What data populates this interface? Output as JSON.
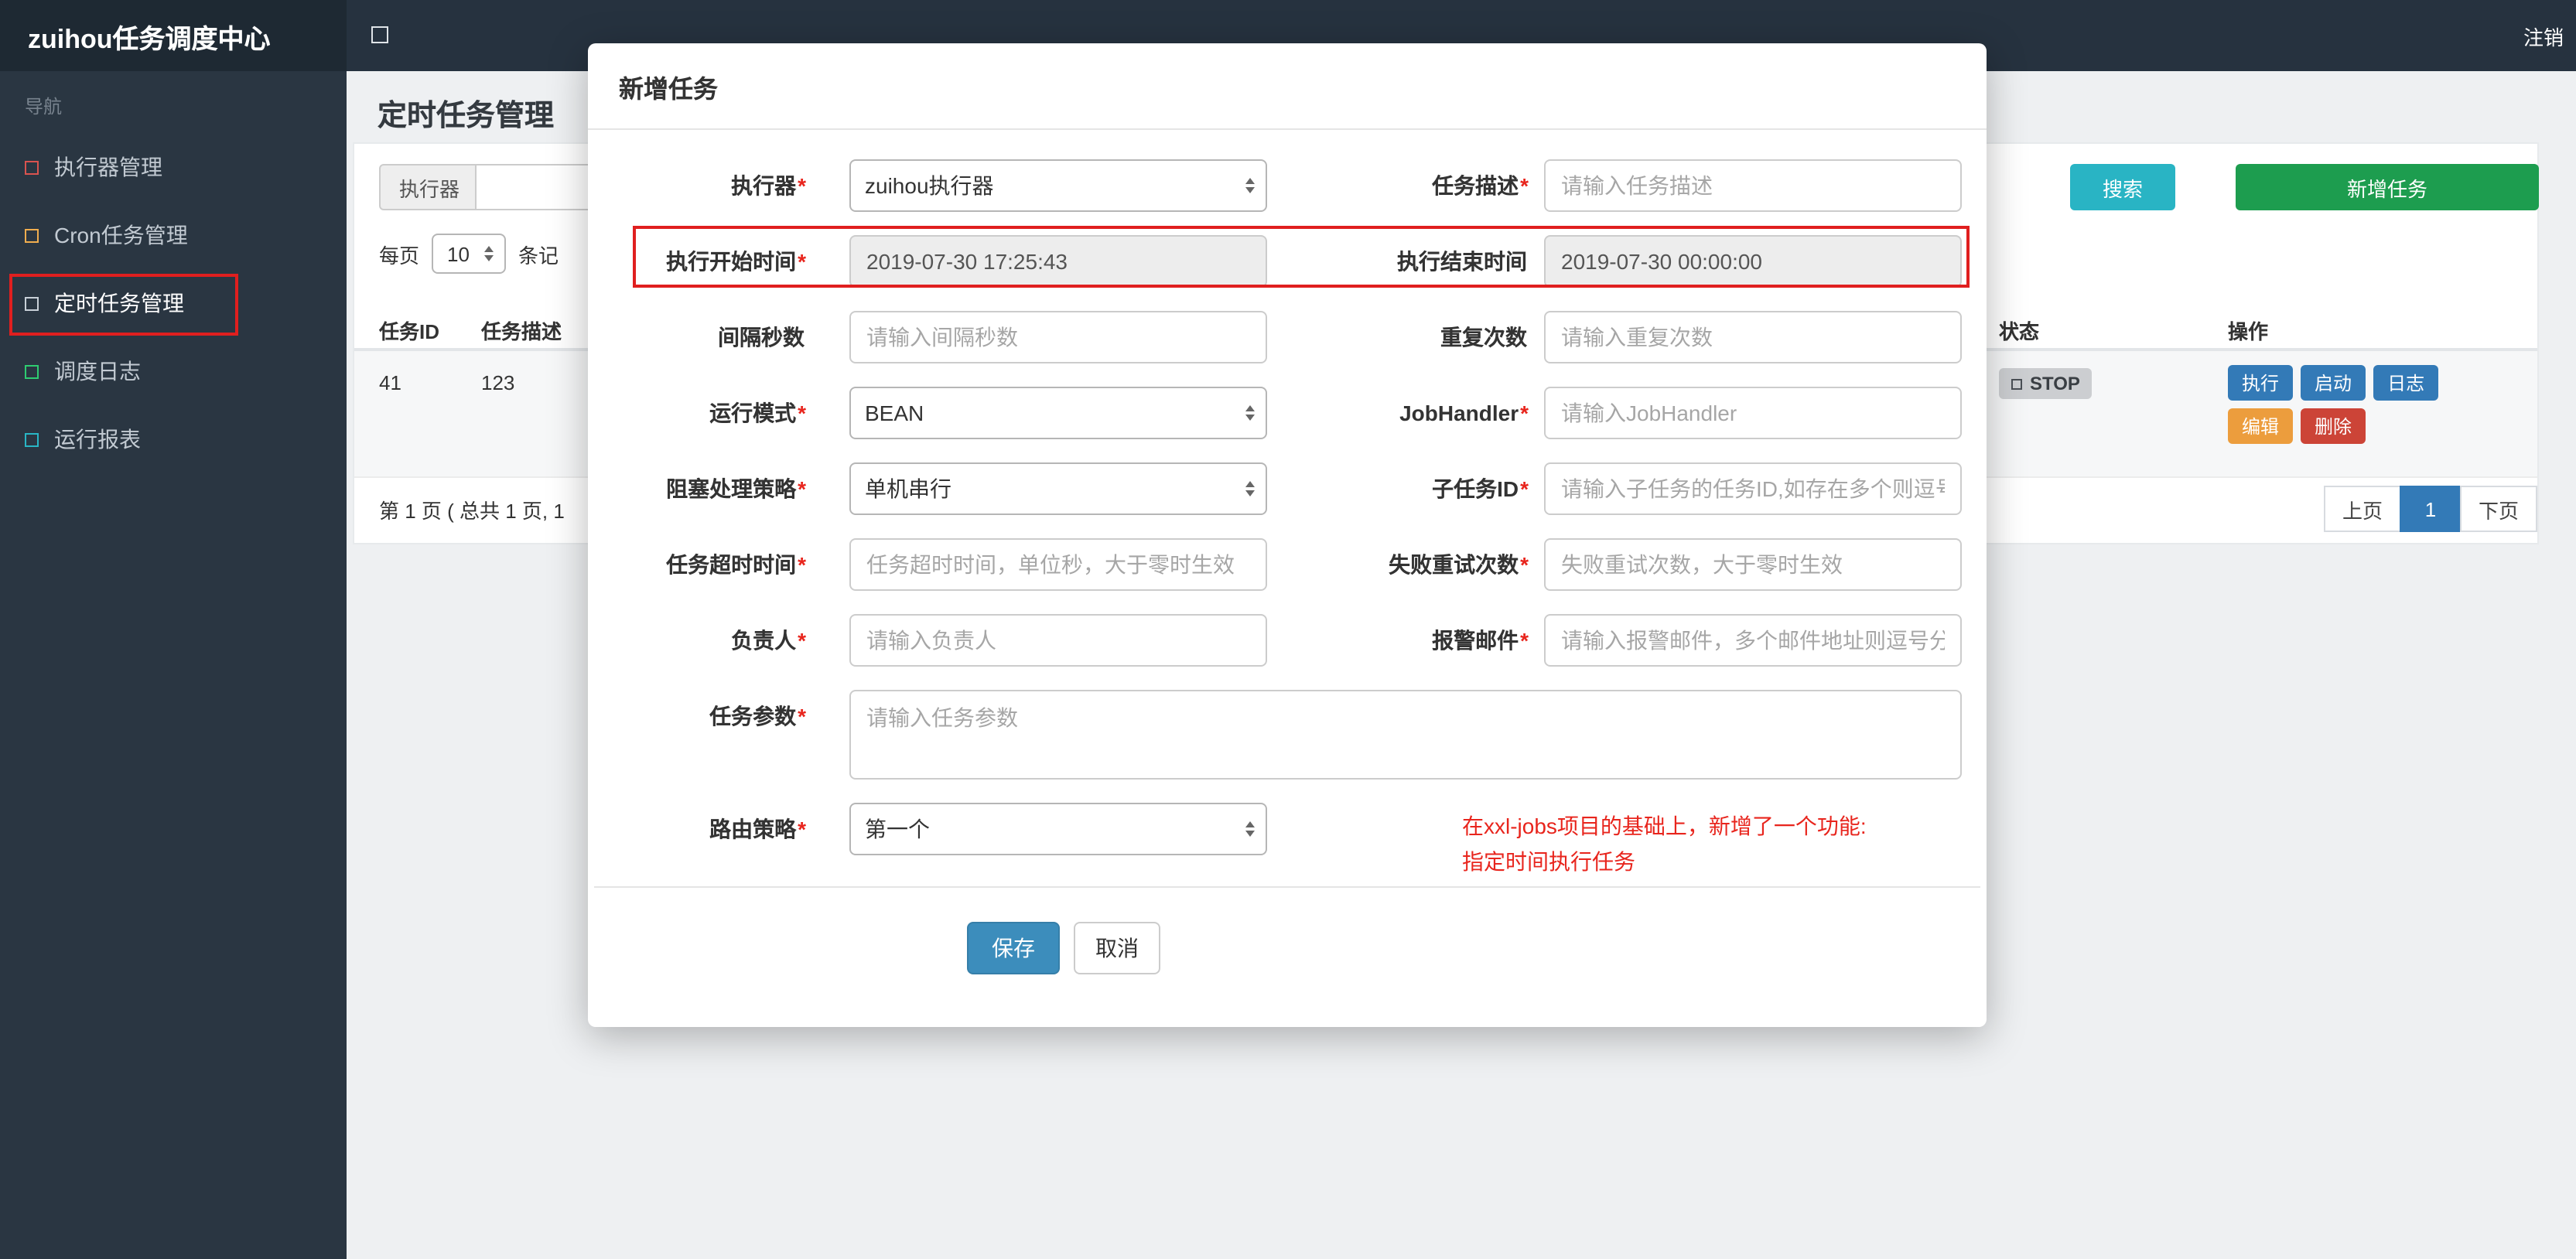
{
  "topbar": {
    "brand": "zuihou任务调度中心",
    "logout": "注销"
  },
  "sidebar": {
    "nav_label": "导航",
    "items": [
      {
        "label": "执行器管理",
        "color": "#d9534f"
      },
      {
        "label": "Cron任务管理",
        "color": "#f0ad4e"
      },
      {
        "label": "定时任务管理",
        "color": "#c8d0d8"
      },
      {
        "label": "调度日志",
        "color": "#2ecc71"
      },
      {
        "label": "运行报表",
        "color": "#29b6c5"
      }
    ]
  },
  "page": {
    "title": "定时任务管理",
    "toolbar": {
      "filter_label": "执行器",
      "search": "搜索",
      "add": "新增任务"
    },
    "perpage": {
      "prefix": "每页",
      "value": "10",
      "suffix": "条记"
    },
    "table": {
      "headers": [
        "任务ID",
        "任务描述",
        "状态",
        "操作"
      ],
      "row": {
        "id": "41",
        "desc": "123",
        "status": "STOP",
        "actions": {
          "run": "执行",
          "start": "启动",
          "log": "日志",
          "edit": "编辑",
          "del": "删除"
        }
      }
    },
    "pagination": {
      "summary": "第 1 页 ( 总共 1 页, 1",
      "prev": "上页",
      "current": "1",
      "next": "下页"
    }
  },
  "modal": {
    "title": "新增任务",
    "fields": [
      {
        "label": "执行器",
        "required": "*",
        "value": "zuihou执行器"
      },
      {
        "label": "任务描述",
        "required": "*",
        "placeholder": "请输入任务描述"
      },
      {
        "label": "执行开始时间",
        "required": "*",
        "value": "2019-07-30 17:25:43"
      },
      {
        "label": "执行结束时间",
        "required": "",
        "value": "2019-07-30 00:00:00"
      },
      {
        "label": "间隔秒数",
        "required": "",
        "placeholder": "请输入间隔秒数"
      },
      {
        "label": "重复次数",
        "required": "",
        "placeholder": "请输入重复次数"
      },
      {
        "label": "运行模式",
        "required": "*",
        "value": "BEAN"
      },
      {
        "label": "JobHandler",
        "required": "*",
        "placeholder": "请输入JobHandler"
      },
      {
        "label": "阻塞处理策略",
        "required": "*",
        "value": "单机串行"
      },
      {
        "label": "子任务ID",
        "required": "*",
        "placeholder": "请输入子任务的任务ID,如存在多个则逗号分隔"
      },
      {
        "label": "任务超时时间",
        "required": "*",
        "placeholder": "任务超时时间，单位秒，大于零时生效"
      },
      {
        "label": "失败重试次数",
        "required": "*",
        "placeholder": "失败重试次数，大于零时生效"
      },
      {
        "label": "负责人",
        "required": "*",
        "placeholder": "请输入负责人"
      },
      {
        "label": "报警邮件",
        "required": "*",
        "placeholder": "请输入报警邮件，多个邮件地址则逗号分隔"
      },
      {
        "label": "任务参数",
        "required": "*",
        "placeholder": "请输入任务参数"
      },
      {
        "label": "路由策略",
        "required": "*",
        "value": "第一个"
      }
    ],
    "note_line1": "在xxl-jobs项目的基础上，新增了一个功能:",
    "note_line2": "指定时间执行任务",
    "save": "保存",
    "cancel": "取消"
  }
}
